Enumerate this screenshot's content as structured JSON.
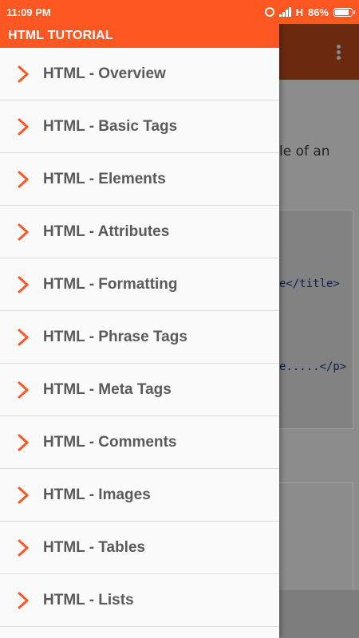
{
  "status_bar": {
    "time": "11:09 PM",
    "network": "H",
    "battery": "86%",
    "battery_level": 0.86
  },
  "drawer": {
    "title": "HTML TUTORIAL",
    "items": [
      {
        "label": "HTML - Overview"
      },
      {
        "label": "HTML - Basic Tags"
      },
      {
        "label": "HTML - Elements"
      },
      {
        "label": "HTML - Attributes"
      },
      {
        "label": "HTML - Formatting"
      },
      {
        "label": "HTML - Phrase Tags"
      },
      {
        "label": "HTML - Meta Tags"
      },
      {
        "label": "HTML - Comments"
      },
      {
        "label": "HTML - Images"
      },
      {
        "label": "HTML - Tables"
      },
      {
        "label": "HTML - Lists"
      }
    ]
  },
  "background_content": {
    "text_fragment": "le of an",
    "code_line_1": "e</title>",
    "code_line_2": "e.....</p>"
  },
  "colors": {
    "accent": "#ff5722",
    "appbar_dimmed": "#6b2a10",
    "item_text": "#5a5a5a"
  },
  "icons": {
    "item_icon": "chevron-right-icon",
    "overflow": "overflow-menu-icon"
  }
}
